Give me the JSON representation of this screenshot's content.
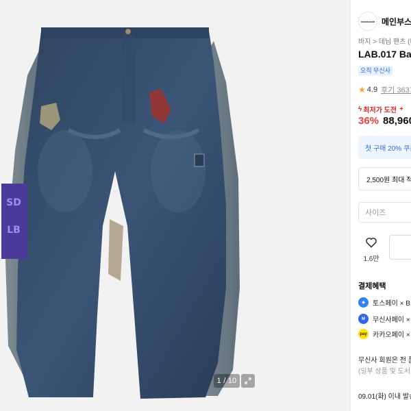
{
  "gallery": {
    "counter": "1 / 10",
    "image_alt": "wide-leg denim jeans with grey side panels and purple patch"
  },
  "brand": {
    "logo_text": "mainbooth",
    "name": "메인부스"
  },
  "breadcrumb": "바지 > 데님 팬츠 (데",
  "product": {
    "title": "LAB.017 Bal",
    "badge": "오직 무신사",
    "rating": "4.9",
    "reviews": "후기 3637"
  },
  "pricing": {
    "lowest_label": "최저가 도전",
    "discount": "36%",
    "price": "88,960"
  },
  "coupon": "첫 구매 20% 쿠폰",
  "point": "2,500원 최대 적립",
  "size_select": {
    "placeholder": "사이즈"
  },
  "like": {
    "count": "1.6만"
  },
  "payment": {
    "title": "결제혜택",
    "items": [
      {
        "label": "토스페이 × B",
        "icon": "toss-pay-icon",
        "color": "#3182f6"
      },
      {
        "label": "무신사페이 ×",
        "icon": "musinsa-pay-icon",
        "color": "#2f63f2"
      },
      {
        "label": "카카오페이 ×",
        "icon": "kakao-pay-icon",
        "color": "#fee500"
      }
    ]
  },
  "member": {
    "text": "무신사 회원은 전 품",
    "sub": "(일부 상품 및 도서"
  },
  "shipping": "09.01(화) 이내 발송"
}
